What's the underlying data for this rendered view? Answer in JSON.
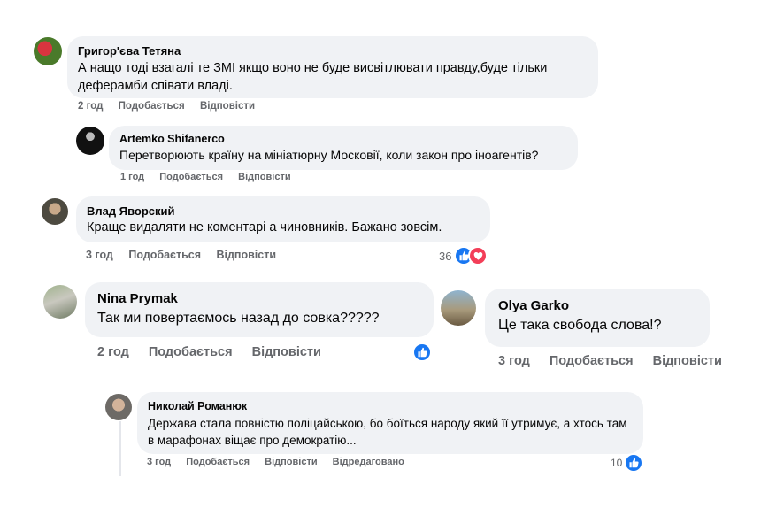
{
  "comments": [
    {
      "author": "Григор'єва Тетяна",
      "text": "А нащо тоді взагалі те ЗМІ якщо воно не буде висвітлювати правду,буде тільки деферамби співати владі.",
      "time": "2 год",
      "like_label": "Подобається",
      "reply_label": "Відповісти"
    },
    {
      "author": "Artemko Shifanerco",
      "text": "Перетворюють країну на мініатюрну Московії, коли закон про іноагентів?",
      "time": "1 год",
      "like_label": "Подобається",
      "reply_label": "Відповісти"
    },
    {
      "author": "Влад Яворский",
      "text": "Краще видаляти не коментарі а чиновників. Бажано зовсім.",
      "time": "3 год",
      "like_label": "Подобається",
      "reply_label": "Відповісти",
      "reaction_count": "36"
    },
    {
      "author": "Nina Prymak",
      "text": "Так ми повертаємось назад до совка?????",
      "time": "2 год",
      "like_label": "Подобається",
      "reply_label": "Відповісти"
    },
    {
      "author": "Olya Garko",
      "text": "Це така свобода слова!?",
      "time": "3 год",
      "like_label": "Подобається",
      "reply_label": "Відповісти"
    },
    {
      "author": "Николай Романюк",
      "text": "Держава стала повністю поліцайською, бо боїться народу який її утримує, а хтось там в марафонах віщає про демократію...",
      "time": "3 год",
      "like_label": "Подобається",
      "reply_label": "Відповісти",
      "edited_label": "Відредаговано",
      "reaction_count": "10"
    }
  ],
  "colors": {
    "bubble": "#f0f2f5",
    "meta_text": "#65676b",
    "like_blue": "#1877f2",
    "love_red": "#f33e58"
  }
}
